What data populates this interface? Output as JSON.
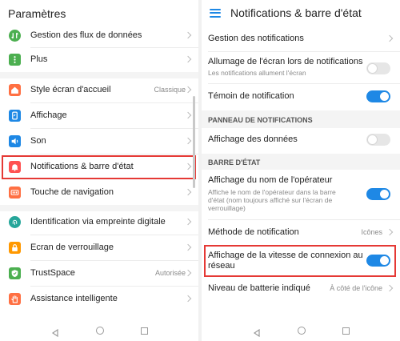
{
  "left": {
    "title": "Paramètres",
    "items": [
      {
        "label": "Gestion des flux de données",
        "icon": "data-flow-icon",
        "color": "#4caf50"
      },
      {
        "label": "Plus",
        "icon": "more-icon",
        "color": "#4caf50"
      },
      {
        "label": "Style écran d'accueil",
        "value": "Classique",
        "icon": "home-style-icon",
        "color": "#ff7043"
      },
      {
        "label": "Affichage",
        "icon": "display-icon",
        "color": "#1e88e5"
      },
      {
        "label": "Son",
        "icon": "sound-icon",
        "color": "#1e88e5"
      },
      {
        "label": "Notifications & barre d'état",
        "icon": "notification-bell-icon",
        "color": "#ff5252"
      },
      {
        "label": "Touche de navigation",
        "icon": "navigation-key-icon",
        "color": "#ff7043"
      },
      {
        "label": "Identification via empreinte digitale",
        "icon": "fingerprint-icon",
        "color": "#26a69a"
      },
      {
        "label": "Ecran de verrouillage",
        "icon": "lock-icon",
        "color": "#ff9800"
      },
      {
        "label": "TrustSpace",
        "value": "Autorisée",
        "icon": "shield-check-icon",
        "color": "#4caf50"
      },
      {
        "label": "Assistance intelligente",
        "icon": "hand-icon",
        "color": "#ff7043"
      }
    ]
  },
  "right": {
    "title": "Notifications & barre d'état",
    "manage": "Gestion des notifications",
    "wake": {
      "label": "Allumage de l'écran lors de notifications",
      "sub": "Les notifications allument l'écran",
      "on": false
    },
    "led": {
      "label": "Témoin de notification",
      "on": true
    },
    "section_panel": "PANNEAU DE NOTIFICATIONS",
    "data_display": {
      "label": "Affichage des données",
      "on": false
    },
    "section_status": "BARRE D'ÉTAT",
    "operator": {
      "label": "Affichage du nom de l'opérateur",
      "sub1": "Affiche le nom de l'opérateur dans la barre",
      "sub2": "d'état (nom toujours affiché sur l'écran de",
      "sub3": "verrouillage)",
      "on": true
    },
    "method": {
      "label": "Méthode de notification",
      "value": "Icônes"
    },
    "speed": {
      "label1": "Affichage de la vitesse de connexion au",
      "label2": "réseau",
      "on": true
    },
    "battery": {
      "label": "Niveau de batterie indiqué",
      "value": "À côté de l'icône"
    }
  },
  "colors": {
    "accent": "#1e88e5",
    "highlight": "#e53935"
  }
}
